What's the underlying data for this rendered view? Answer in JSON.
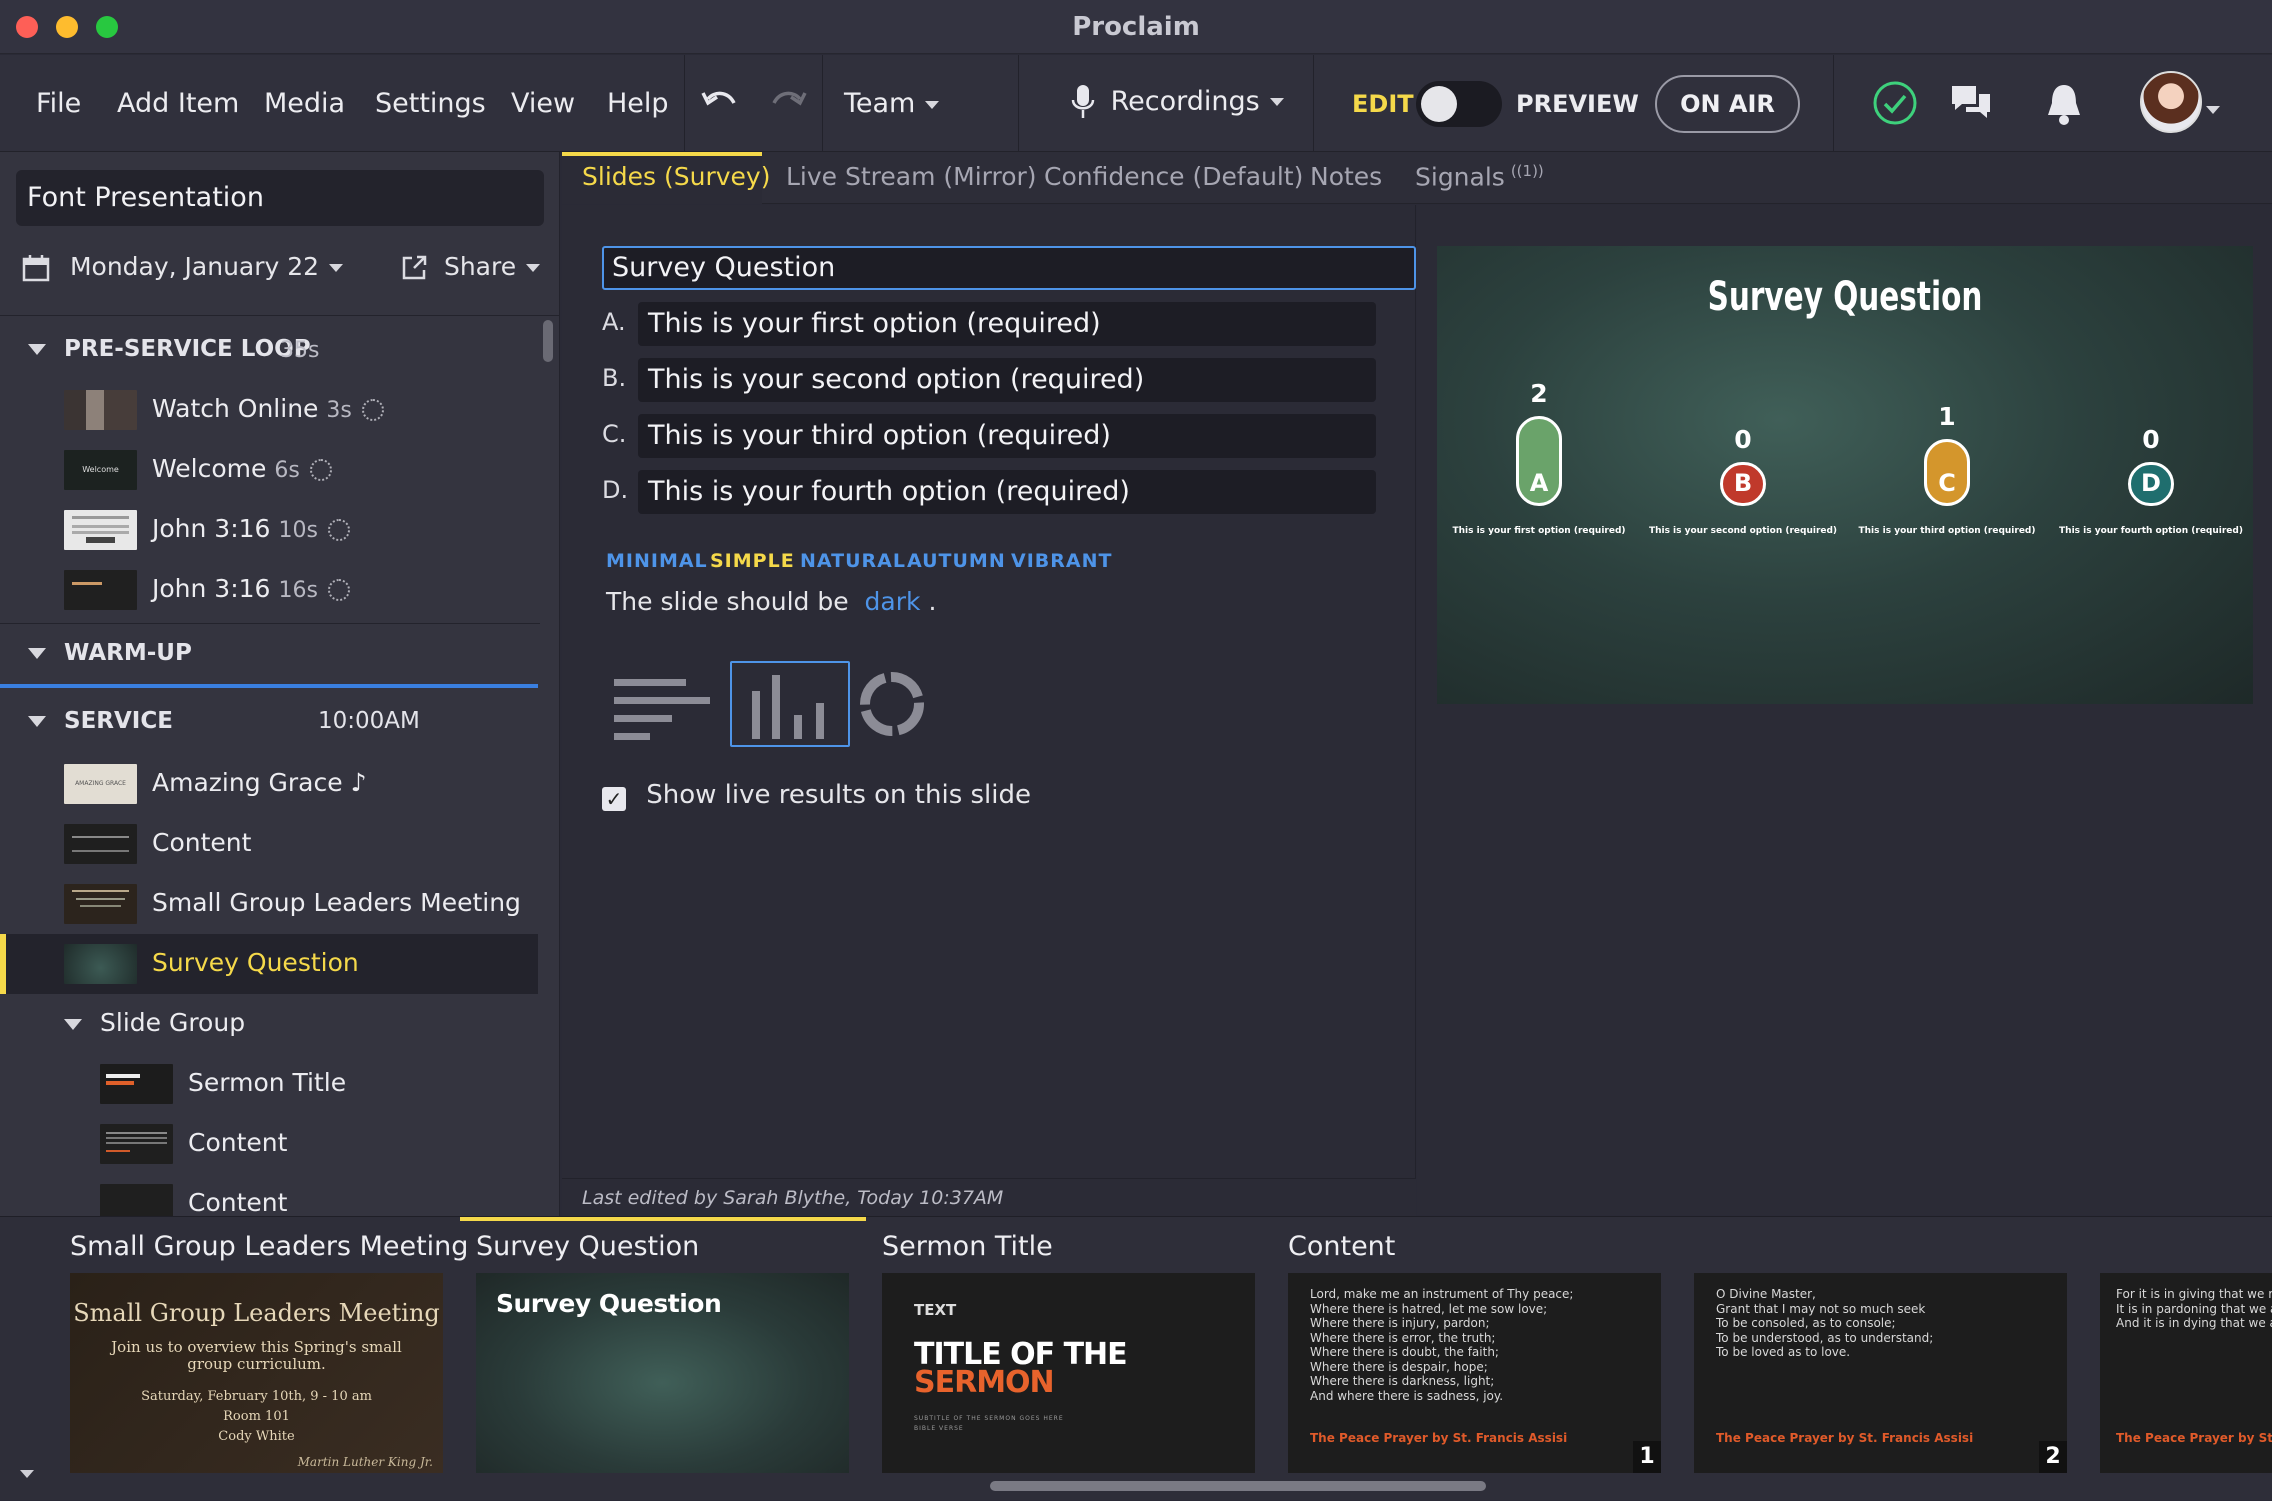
{
  "window": {
    "title": "Proclaim"
  },
  "menu": {
    "items": [
      "File",
      "Add Item",
      "Media",
      "Settings",
      "View",
      "Help"
    ],
    "team": "Team",
    "recordings": "Recordings",
    "edit": "EDIT",
    "preview": "PREVIEW",
    "on_air": "ON AIR"
  },
  "sidebar": {
    "presentation_title": "Font Presentation",
    "date": "Monday, January 22",
    "share": "Share",
    "sections": {
      "pre_service": {
        "name": "PRE-SERVICE LOOP",
        "duration": "35s"
      },
      "warm_up": {
        "name": "WARM-UP"
      },
      "service": {
        "name": "SERVICE",
        "time": "10:00AM"
      }
    },
    "pre_items": [
      {
        "label": "Watch Online",
        "duration": "3s"
      },
      {
        "label": "Welcome",
        "duration": "6s"
      },
      {
        "label": "John 3:16",
        "duration": "10s"
      },
      {
        "label": "John 3:16",
        "duration": "16s"
      }
    ],
    "service_items": [
      {
        "label": "Amazing Grace",
        "note": "♪"
      },
      {
        "label": "Content"
      },
      {
        "label": "Small Group Leaders Meeting"
      },
      {
        "label": "Survey Question"
      }
    ],
    "slide_group": {
      "label": "Slide Group",
      "items": [
        "Sermon Title",
        "Content",
        "Content"
      ]
    }
  },
  "tabs": [
    {
      "label": "Slides (Survey)",
      "active": true
    },
    {
      "label": "Live Stream (Mirror)"
    },
    {
      "label": "Confidence (Default)"
    },
    {
      "label": "Notes"
    },
    {
      "label": "Signals",
      "badge": "((1))"
    }
  ],
  "editor": {
    "question": "Survey Question",
    "options": [
      {
        "letter": "A.",
        "text": "This is your first option (required)"
      },
      {
        "letter": "B.",
        "text": "This is your second option (required)"
      },
      {
        "letter": "C.",
        "text": "This is your third option (required)"
      },
      {
        "letter": "D.",
        "text": "This is your fourth option (required)"
      }
    ],
    "themes": [
      "MINIMAL",
      "SIMPLE",
      "NATURAL",
      "AUTUMN",
      "VIBRANT"
    ],
    "selected_theme": "SIMPLE",
    "slide_should_be": "The slide should be",
    "slide_mode": "dark",
    "period": ".",
    "chart_types": [
      "list",
      "bar",
      "donut"
    ],
    "selected_chart_type": "bar",
    "show_live_results": "Show live results on this slide",
    "show_live_results_checked": true,
    "last_edited": "Last edited by Sarah Blythe, Today 10:37AM"
  },
  "preview": {
    "title": "Survey Question",
    "chart_data": {
      "type": "bar",
      "categories": [
        "A",
        "B",
        "C",
        "D"
      ],
      "values": [
        2,
        0,
        1,
        0
      ],
      "labels": [
        "This is your first option (required)",
        "This is your second option (required)",
        "This is your third option (required)",
        "This is your fourth option (required)"
      ],
      "colors": [
        "#6aa36a",
        "#c0392b",
        "#d4962c",
        "#1f6e6e"
      ]
    }
  },
  "filmstrip": [
    {
      "title": "Small Group Leaders Meeting",
      "thumb_title": "Small Group Leaders Meeting",
      "thumb_body": "Join us to overview this Spring's small group curriculum.",
      "thumb_date": "Saturday, February 10th, 9 - 10 am",
      "thumb_room": "Room 101",
      "thumb_name": "Cody White",
      "thumb_signature": "Martin Luther King Jr."
    },
    {
      "title": "Survey Question",
      "thumb_title": "Survey Question"
    },
    {
      "title": "Sermon Title",
      "thumb_label": "TEXT",
      "thumb_line1": "TITLE OF THE",
      "thumb_line2": "SERMON",
      "thumb_sub": "SUBTITLE OF THE SERMON GOES HERE",
      "thumb_verse": "BIBLE VERSE"
    },
    {
      "title": "Content",
      "thumb_text": "Lord, make me an instrument of Thy peace;\nWhere there is hatred, let me sow love;\nWhere there is injury, pardon;\nWhere there is error, the truth;\nWhere there is doubt, the faith;\nWhere there is despair, hope;\nWhere there is darkness, light;\nAnd where there is sadness, joy.",
      "thumb_footer": "The Peace Prayer by St. Francis Assisi",
      "number": "1"
    },
    {
      "title": "",
      "thumb_text": "O Divine Master,\nGrant that I may not so much seek\nTo be consoled, as to console;\nTo be understood, as to understand;\nTo be loved as to love.",
      "thumb_footer": "The Peace Prayer by St. Francis Assisi",
      "number": "2"
    },
    {
      "title": "",
      "thumb_text": "For it is in giving that we rec\nIt is in pardoning that we are\nAnd it is in dying that we are",
      "thumb_footer": "The Peace Prayer by St."
    }
  ]
}
